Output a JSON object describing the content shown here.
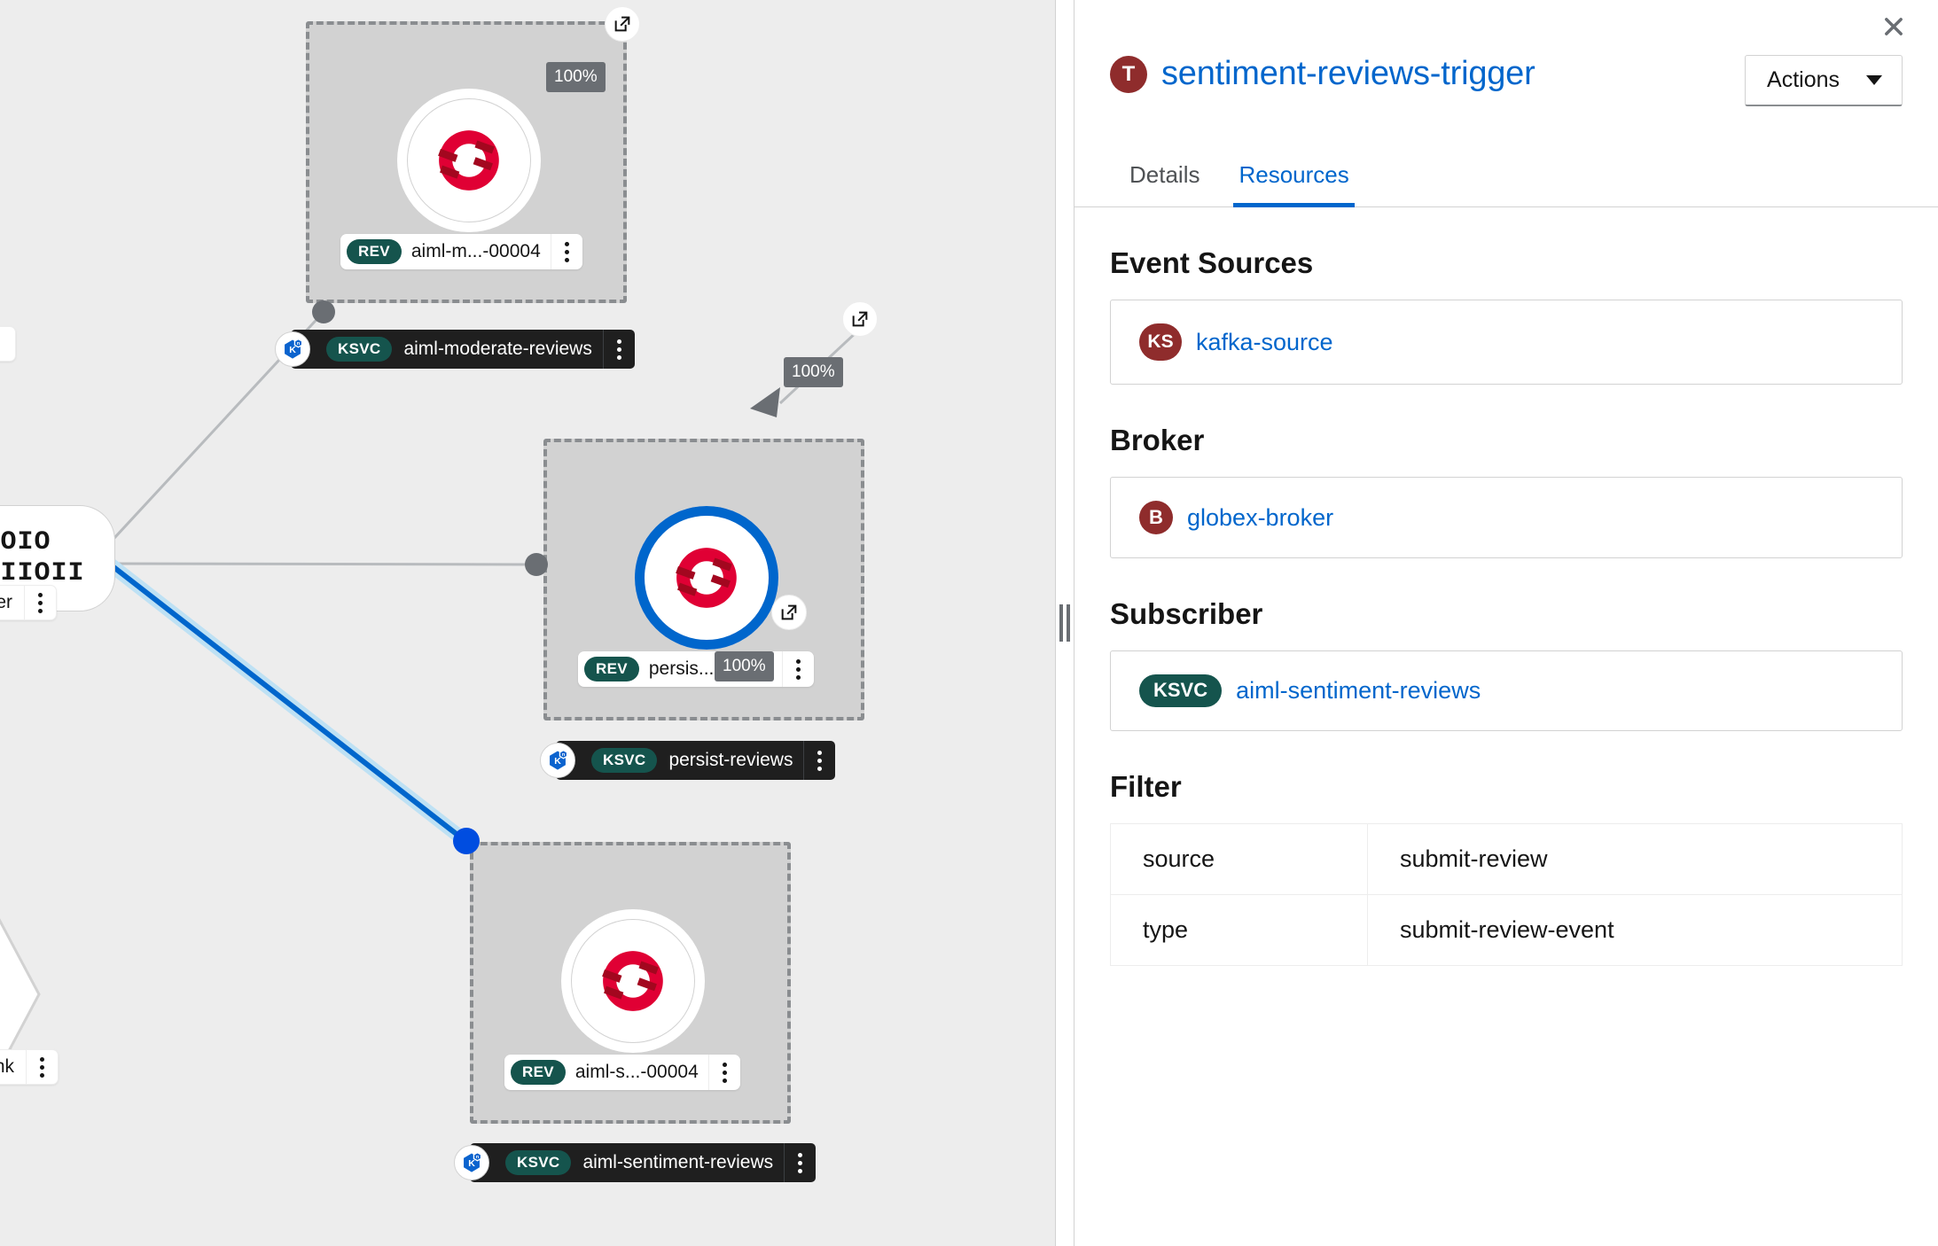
{
  "panel": {
    "close_icon": "close-icon",
    "type_badge": "T",
    "title": "sentiment-reviews-trigger",
    "actions_label": "Actions",
    "tabs": [
      {
        "label": "Details",
        "active": false
      },
      {
        "label": "Resources",
        "active": true
      }
    ],
    "sections": {
      "event_sources": {
        "heading": "Event Sources",
        "items": [
          {
            "badge": "KS",
            "name": "kafka-source"
          }
        ]
      },
      "broker": {
        "heading": "Broker",
        "items": [
          {
            "badge": "B",
            "name": "globex-broker"
          }
        ]
      },
      "subscriber": {
        "heading": "Subscriber",
        "items": [
          {
            "badge": "KSVC",
            "name": "aiml-sentiment-reviews"
          }
        ]
      },
      "filter": {
        "heading": "Filter",
        "rows": [
          {
            "key": "source",
            "value": "submit-review"
          },
          {
            "key": "type",
            "value": "submit-review-event"
          }
        ]
      }
    }
  },
  "graph": {
    "nodes": [
      {
        "id": "aiml-moderate-reviews",
        "traffic": "100%",
        "revision_badge": "REV",
        "revision_name": "aiml-m...-00004",
        "service_badge": "KSVC",
        "service_name": "aiml-moderate-reviews",
        "selected": false
      },
      {
        "id": "persist-reviews",
        "traffic": "100%",
        "revision_badge": "REV",
        "revision_name": "persis...-00001",
        "service_badge": "KSVC",
        "service_name": "persist-reviews",
        "selected": true
      },
      {
        "id": "aiml-sentiment-reviews",
        "traffic": "100%",
        "revision_badge": "REV",
        "revision_name": "aiml-s...-00004",
        "service_badge": "KSVC",
        "service_name": "aiml-sentiment-reviews",
        "selected": false
      }
    ],
    "broker_node": {
      "glyph_line1": "IO IOIO",
      "glyph_line2": "OII IIOII",
      "label": "obex-broker"
    },
    "sink_node": {
      "label": "ws-sink"
    }
  },
  "colors": {
    "accent_blue": "#0066cc",
    "edge_blue": "#004de0",
    "badge_teal": "#15544d",
    "badge_maroon": "#8f2c2c",
    "red_logo": "#e00034",
    "graph_bg": "#ededed",
    "group_bg": "#d2d2d2"
  }
}
